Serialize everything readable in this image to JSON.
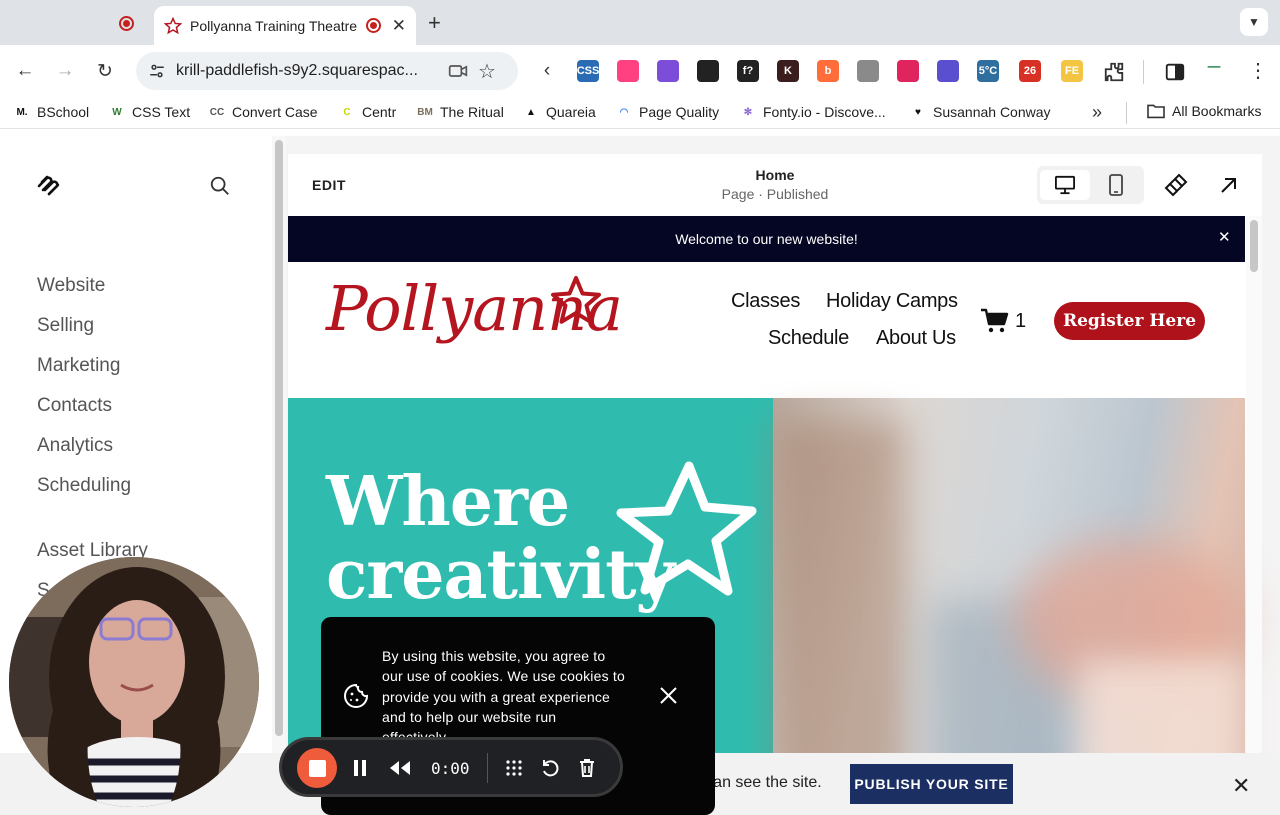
{
  "browser": {
    "tabs": [
      {
        "title": ""
      },
      {
        "title": "Pollyanna Training Theatre"
      }
    ],
    "url": "krill-paddlefish-s9y2.squarespac...",
    "extensions": [
      {
        "icon": "css-extension-icon",
        "label": "CSS",
        "color": "#2a6cb4"
      },
      {
        "icon": "color-wheel-extension-icon",
        "label": "",
        "color": "#ff4081"
      },
      {
        "icon": "flower-extension-icon",
        "label": "",
        "color": "#7b4dd8"
      },
      {
        "icon": "grid-extension-icon",
        "label": "",
        "color": "#222222"
      },
      {
        "icon": "font-extension-icon",
        "label": "f?",
        "color": "#222222"
      },
      {
        "icon": "k-extension-icon",
        "label": "K",
        "color": "#3b1d1d"
      },
      {
        "icon": "swirl-extension-icon",
        "label": "b",
        "color": "#ff6d3a"
      },
      {
        "icon": "camera-extension-icon",
        "label": "",
        "color": "#8a8a8a"
      },
      {
        "icon": "pocket-extension-icon",
        "label": "",
        "color": "#e0245e"
      },
      {
        "icon": "globe-extension-icon",
        "label": "",
        "color": "#5a4fcf"
      },
      {
        "icon": "weather-extension-icon",
        "label": "5°C",
        "color": "#2f6f9f"
      },
      {
        "icon": "calendar-extension-icon",
        "label": "26",
        "color": "#d93025"
      },
      {
        "icon": "fe-extension-icon",
        "label": "FE",
        "color": "#f4c542"
      }
    ],
    "bookmarks": [
      {
        "label": "BSchool",
        "icon": "M.",
        "color": "#111111"
      },
      {
        "label": "CSS Text",
        "icon": "W",
        "color": "#2e7d32"
      },
      {
        "label": "Convert Case",
        "icon": "CC",
        "color": "#555555"
      },
      {
        "label": "Centr",
        "icon": "C",
        "color": "#c6d600"
      },
      {
        "label": "The Ritual",
        "icon": "BM",
        "color": "#7a6f5a"
      },
      {
        "label": "Quareia",
        "icon": "▲",
        "color": "#111111"
      },
      {
        "label": "Page Quality",
        "icon": "◠",
        "color": "#4285f4"
      },
      {
        "label": "Fonty.io - Discove...",
        "icon": "✻",
        "color": "#8e6bd8"
      },
      {
        "label": "Susannah Conway",
        "icon": "♥",
        "color": "#111111"
      }
    ],
    "all_bookmarks_label": "All Bookmarks"
  },
  "sidebar": {
    "items": [
      {
        "label": "Website"
      },
      {
        "label": "Selling"
      },
      {
        "label": "Marketing"
      },
      {
        "label": "Contacts"
      },
      {
        "label": "Analytics"
      },
      {
        "label": "Scheduling"
      },
      {
        "label": "Asset Library"
      },
      {
        "label": "S"
      }
    ]
  },
  "editor": {
    "edit_label": "EDIT",
    "page_title": "Home",
    "page_status": "Page · Published"
  },
  "site": {
    "announcement": "Welcome to our new website!",
    "logo_text": "Pollyanna",
    "nav": [
      "Classes",
      "Holiday Camps",
      "Schedule",
      "About Us"
    ],
    "cart_count": "1",
    "register_label": "Register Here",
    "hero_lines": [
      "Where",
      "creativity"
    ],
    "accent_color": "#b0121b",
    "hero_color": "#2fbcae"
  },
  "cookie": {
    "text": "By using this website, you agree to our use of cookies. We use cookies to provide you with a great experience and to help our website run effectively."
  },
  "publish": {
    "text": "ne password can see the site.",
    "button_label": "PUBLISH YOUR SITE"
  },
  "recorder": {
    "time": "0:00"
  }
}
